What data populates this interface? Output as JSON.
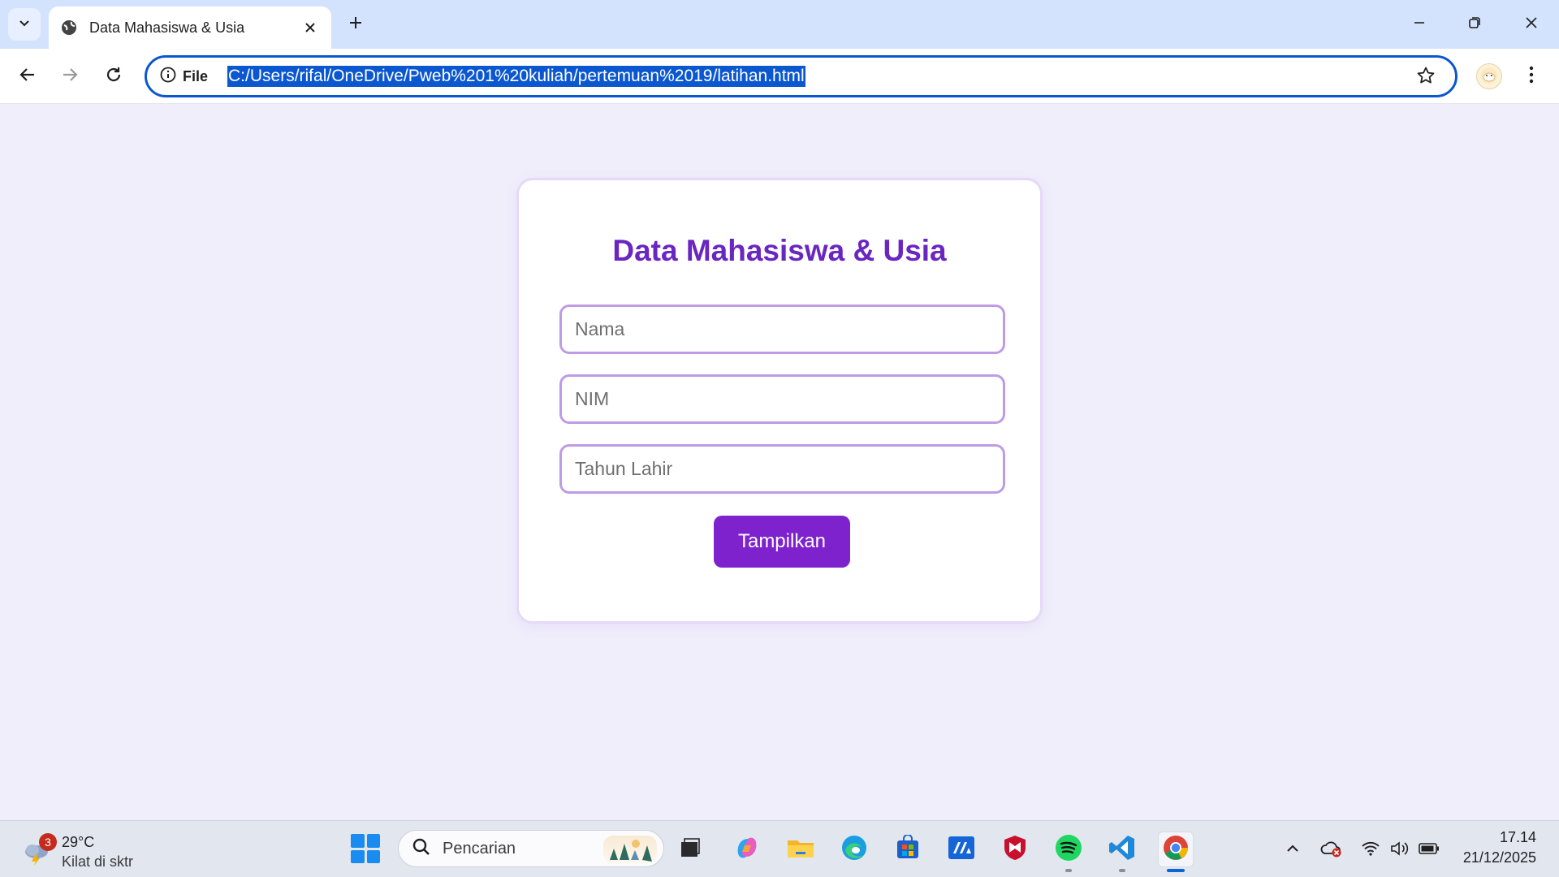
{
  "browser": {
    "tab_title": "Data Mahasiswa & Usia",
    "site_info_label": "File",
    "url": "C:/Users/rifal/OneDrive/Pweb%201%20kuliah/pertemuan%2019/latihan.html"
  },
  "form": {
    "title": "Data Mahasiswa & Usia",
    "nama_placeholder": "Nama",
    "nim_placeholder": "NIM",
    "tahun_placeholder": "Tahun Lahir",
    "submit_label": "Tampilkan"
  },
  "taskbar": {
    "weather_badge": "3",
    "weather_temp": "29°C",
    "weather_desc": "Kilat di sktr",
    "search_placeholder": "Pencarian",
    "time": "17.14",
    "date": "21/12/2025"
  },
  "colors": {
    "accent": "#7e22ce",
    "title": "#6a26c0",
    "page_bg": "#f0eefb",
    "url_highlight": "#0b57d0"
  }
}
